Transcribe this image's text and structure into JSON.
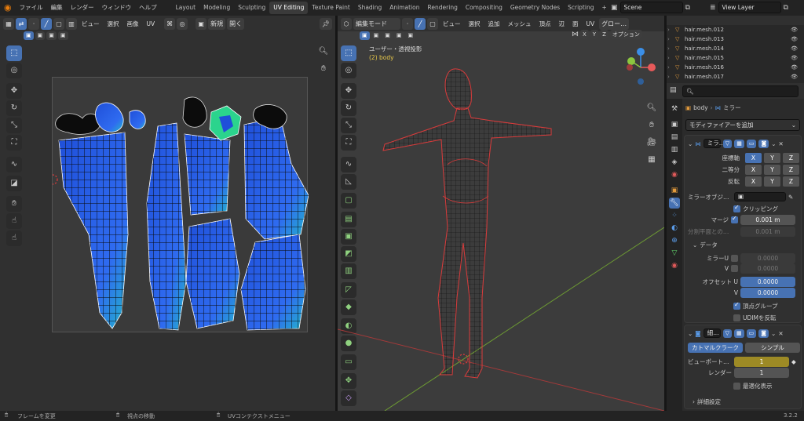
{
  "topbar": {
    "menus": [
      "ファイル",
      "編集",
      "レンダー",
      "ウィンドウ",
      "ヘルプ"
    ],
    "workspaces": [
      "Layout",
      "Modeling",
      "Sculpting",
      "UV Editing",
      "Texture Paint",
      "Shading",
      "Animation",
      "Rendering",
      "Compositing",
      "Geometry Nodes",
      "Scripting"
    ],
    "active_workspace": "UV Editing",
    "add_tab": "+",
    "scene": "Scene",
    "view_layer": "View Layer"
  },
  "uv_editor": {
    "menus": [
      "ビュー",
      "選択",
      "画像",
      "UV"
    ],
    "new_label": "新規",
    "open_label": "開く"
  },
  "viewport": {
    "mode": "編集モード",
    "menus": [
      "ビュー",
      "選択",
      "追加",
      "メッシュ",
      "頂点",
      "辺",
      "面",
      "UV"
    ],
    "transform_orientation": "グロー…",
    "options_label": "オプション",
    "axis_x": "X",
    "axis_y": "Y",
    "axis_z": "Z",
    "view_title": "ユーザー・透視投影",
    "view_subtitle": "(2) body"
  },
  "outliner": {
    "items": [
      "hair.mesh.012",
      "hair.mesh.013",
      "hair.mesh.014",
      "hair.mesh.015",
      "hair.mesh.016",
      "hair.mesh.017"
    ]
  },
  "properties": {
    "object_name": "body",
    "modifier_context": "ミラー",
    "add_modifier": "モディファイアーを追加",
    "mirror": {
      "name": "ミラ…",
      "axis_label": "座標軸",
      "bisect_label": "二等分",
      "flip_label": "反転",
      "x": "X",
      "y": "Y",
      "z": "Z",
      "mirror_object_label": "ミラーオブジ…",
      "clipping_label": "クリッピング",
      "merge_label": "マージ",
      "merge_value": "0.001 m",
      "bisect_dist_label": "分割平面との…",
      "bisect_dist_value": "0.001 m",
      "data_label": "データ",
      "mirror_u_label": "ミラーU",
      "mirror_u_value": "0.0000",
      "v_label": "V",
      "mirror_v_value": "0.0000",
      "offset_u_label": "オフセット U",
      "offset_u_value": "0.0000",
      "offset_v_value": "0.0000",
      "vertex_groups_label": "頂点グループ",
      "udim_label": "UDIMを反転"
    },
    "subsurf": {
      "name": "細…",
      "catmull_label": "カトマルクラーク",
      "simple_label": "シンプル",
      "viewport_label": "ビューポート…",
      "viewport_value": "1",
      "render_label": "レンダー",
      "render_value": "1",
      "optimal_label": "最適化表示",
      "advanced_label": "詳細設定"
    }
  },
  "statusbar": {
    "frame_change": "フレームを変更",
    "move_view": "視点の移動",
    "uv_context": "UVコンテクストメニュー",
    "version": "3.2.2"
  },
  "colors": {
    "accent": "#4772b3",
    "uv_fill": "#2f63e0",
    "wire_select": "#e33b3b",
    "x_axis": "#e85a5a",
    "y_axis": "#8cc63f",
    "z_axis": "#3b8fe8"
  }
}
